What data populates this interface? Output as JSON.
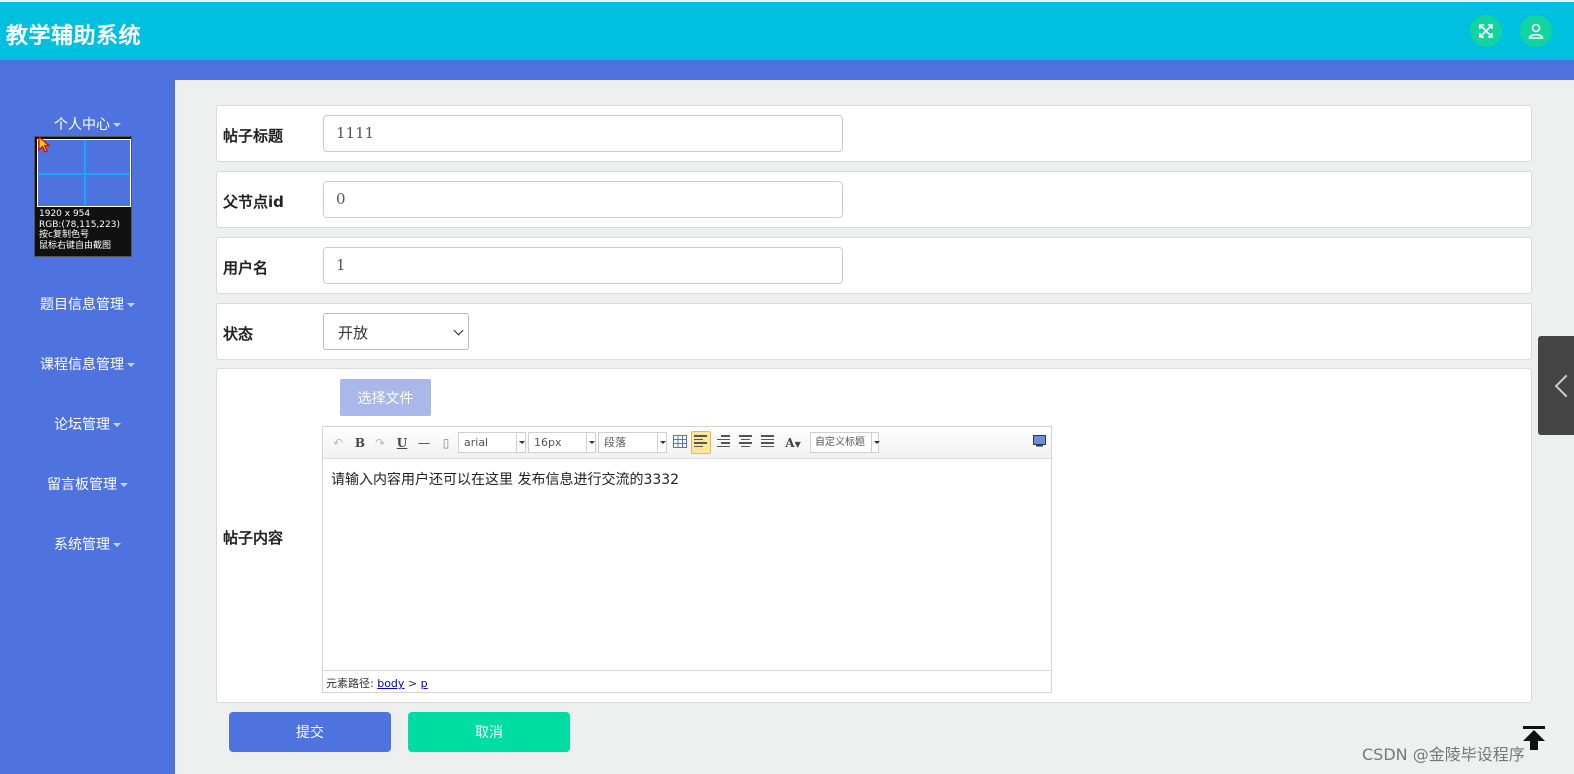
{
  "header": {
    "title": "教学辅助系统",
    "icons": [
      "fullscreen-icon",
      "user-icon"
    ]
  },
  "sidebar": {
    "items": [
      {
        "label": "个人中心"
      },
      {
        "label": "题目信息管理"
      },
      {
        "label": "课程信息管理"
      },
      {
        "label": "论坛管理"
      },
      {
        "label": "留言板管理"
      },
      {
        "label": "系统管理"
      }
    ]
  },
  "color_picker_overlay": {
    "line1": "1920 x 954",
    "line2": "RGB:(78,115,223)",
    "line3": "按c复制色号",
    "line4": "鼠标右键自由截图"
  },
  "form": {
    "title": {
      "label": "帖子标题",
      "value": "1111"
    },
    "parent_id": {
      "label": "父节点id",
      "value": "0"
    },
    "username": {
      "label": "用户名",
      "value": "1"
    },
    "status": {
      "label": "状态",
      "value": "开放"
    },
    "content": {
      "label": "帖子内容",
      "file_button": "选择文件",
      "text": "请输入内容用户还可以在这里 发布信息进行交流的3332"
    }
  },
  "editor_toolbar": {
    "bold": "B",
    "underline": "U",
    "font_family": "arial",
    "font_size": "16px",
    "paragraph": "段落",
    "font_color": "A",
    "custom_heading": "自定义标题"
  },
  "editor_status": {
    "path_label": "元素路径:",
    "path_body": "body",
    "separator": ">",
    "path_p": "p"
  },
  "actions": {
    "submit": "提交",
    "cancel": "取消"
  },
  "watermark": "CSDN @金陵毕设程序",
  "colors": {
    "header": "#00c0e0",
    "sidebar": "#4e73df",
    "submit": "#4e73df",
    "cancel": "#00dda3",
    "header_button": "#12d49f"
  }
}
